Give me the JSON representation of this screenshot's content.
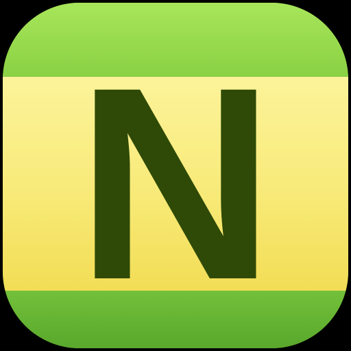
{
  "icon": {
    "letter": "N",
    "colors": {
      "band_top": "#a8e55a",
      "band_bottom": "#5aa82c",
      "label": "#f8ea78",
      "letter": "#2f4a07",
      "background": "#000000"
    }
  }
}
